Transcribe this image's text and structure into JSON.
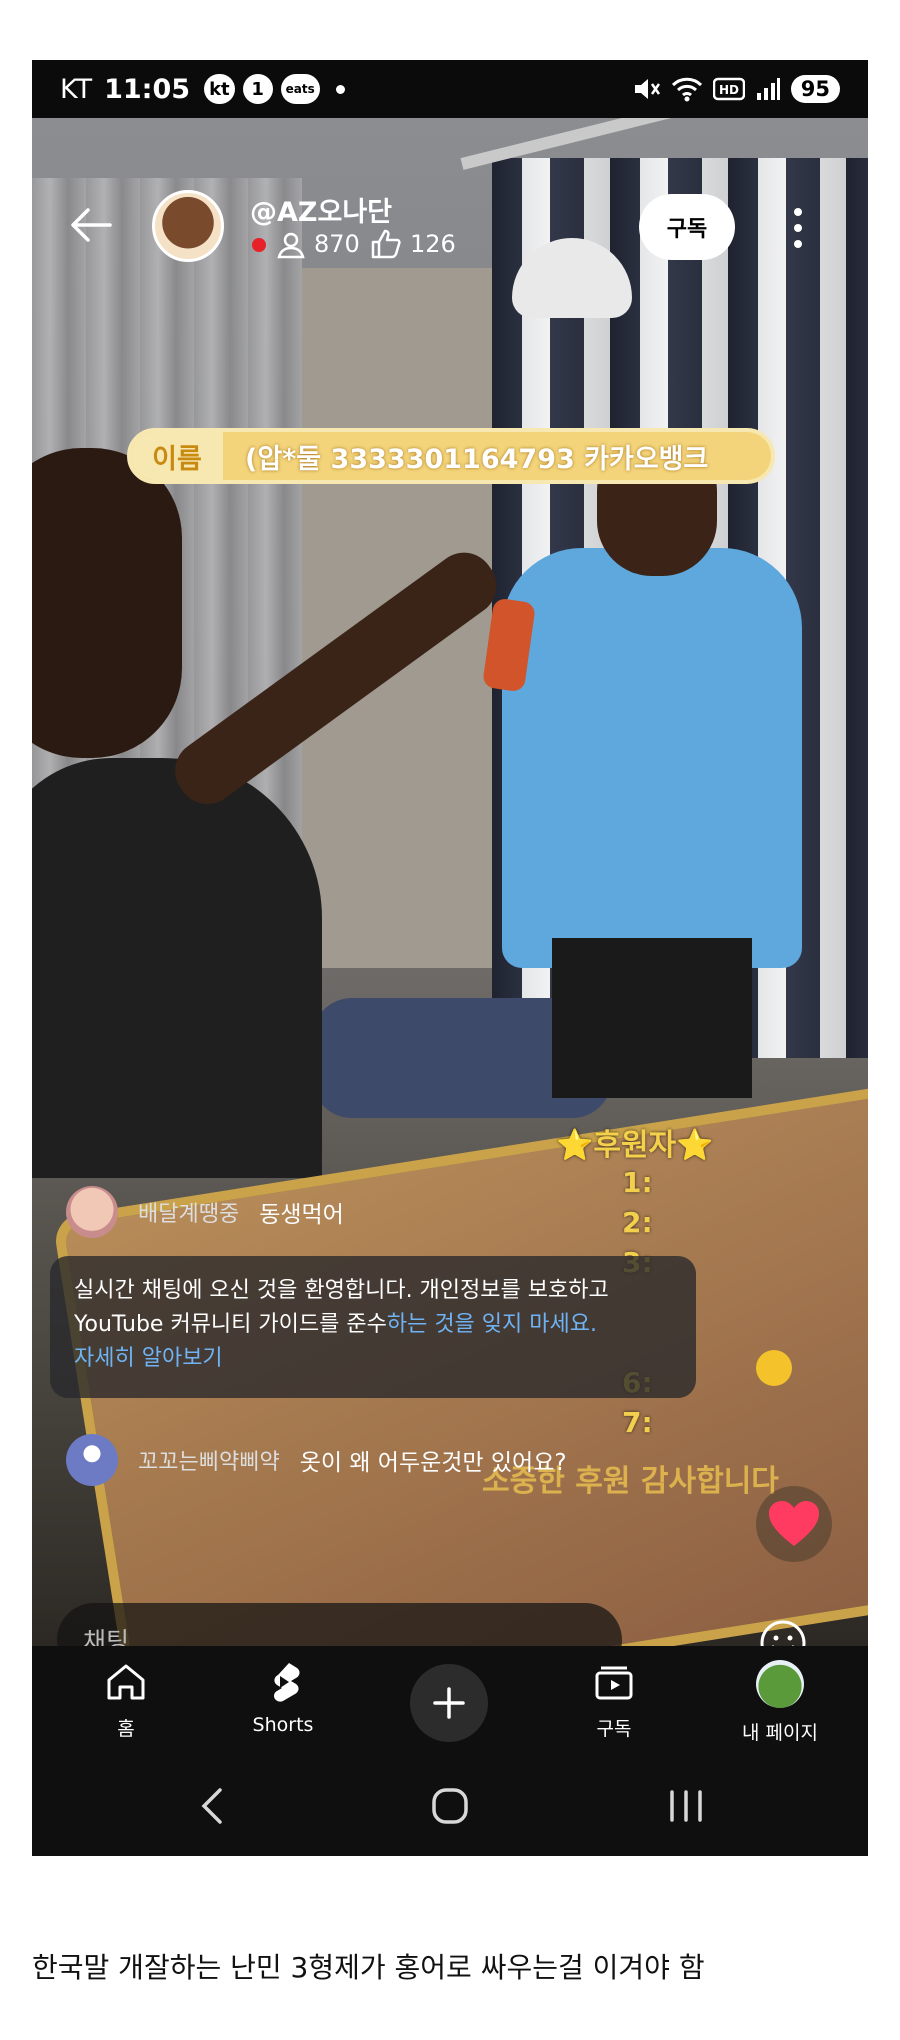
{
  "status_bar": {
    "carrier": "KT",
    "time": "11:05",
    "badges": [
      "kt",
      "1",
      "eats"
    ],
    "battery": "95"
  },
  "header": {
    "channel_name": "@AZ오나단",
    "viewers": "870",
    "likes": "126",
    "subscribe_label": "구독"
  },
  "banner": {
    "label": "이름",
    "text": "(압*둘 3333301164793 카카오뱅크"
  },
  "sponsors": {
    "title": "⭐후원자⭐",
    "lines": [
      "1:",
      "2:",
      "3:",
      "6:",
      "7:"
    ],
    "thanks": "소중한 후원 감사합니다"
  },
  "chat": {
    "messages": [
      {
        "author": "배달계땡중",
        "text": "동생먹어"
      },
      {
        "author": "꼬꼬는삐약삐약",
        "text": "옷이 왜 어두운것만 있어요?"
      }
    ],
    "welcome_plain": "실시간 채팅에 오신 것을 환영합니다. 개인정보를 보호하고 YouTube 커뮤니티 가이드를 준수",
    "welcome_highlight": "하는 것을 잊지 마세요.",
    "learn_more": "자세히 알아보기",
    "input_placeholder": "채팅..."
  },
  "bottom_nav": {
    "home": "홈",
    "shorts": "Shorts",
    "subscriptions": "구독",
    "my_page": "내 페이지"
  },
  "caption": "한국말 개잘하는 난민 3형제가 홍어로 싸우는걸 이겨야 함",
  "colors": {
    "live_red": "#e8202a",
    "banner_yellow": "#f3d47a",
    "sponsor_gold": "#f2cf4c",
    "link_blue": "#6fb3f5",
    "heart_pink": "#ff3b62"
  }
}
